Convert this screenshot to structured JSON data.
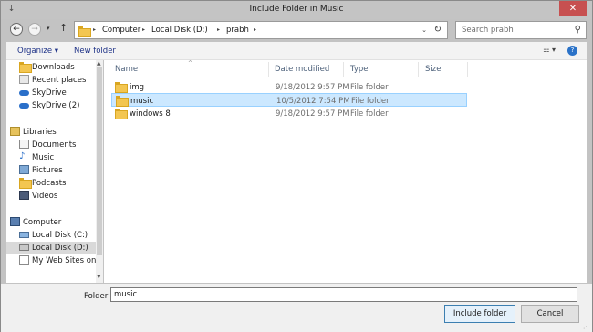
{
  "window": {
    "title": "Include Folder in Music",
    "close_glyph": "✕",
    "sys_icon": "↓"
  },
  "navigation": {
    "back_glyph": "←",
    "forward_glyph": "→",
    "recent_glyph": "▾",
    "up_glyph": "↑",
    "breadcrumb": [
      "Computer",
      "Local Disk (D:)",
      "prabh"
    ],
    "breadcrumb_sep": "▸",
    "dropdown_glyph": "⌄",
    "refresh_glyph": "↻"
  },
  "search": {
    "placeholder": "Search prabh",
    "icon_glyph": "⚲"
  },
  "toolbar": {
    "organize_label": "Organize ▾",
    "new_folder_label": "New folder",
    "view_glyph": "☷ ▾",
    "help_glyph": "?"
  },
  "sidebar": {
    "items": [
      {
        "label": "Downloads",
        "icon": "downloads-icon"
      },
      {
        "label": "Recent places",
        "icon": "recent-places-icon"
      },
      {
        "label": "SkyDrive",
        "icon": "skydrive-icon"
      },
      {
        "label": "SkyDrive (2)",
        "icon": "skydrive-icon"
      },
      {
        "label": "Libraries",
        "icon": "libraries-icon"
      },
      {
        "label": "Documents",
        "icon": "documents-icon"
      },
      {
        "label": "Music",
        "icon": "music-icon"
      },
      {
        "label": "Pictures",
        "icon": "pictures-icon"
      },
      {
        "label": "Podcasts",
        "icon": "podcasts-icon"
      },
      {
        "label": "Videos",
        "icon": "videos-icon"
      },
      {
        "label": "Computer",
        "icon": "computer-icon"
      },
      {
        "label": "Local Disk (C:)",
        "icon": "drive-icon"
      },
      {
        "label": "Local Disk (D:)",
        "icon": "drive-icon",
        "selected": true
      },
      {
        "label": "My Web Sites on",
        "icon": "web-sites-icon"
      }
    ],
    "scroll_up_glyph": "▲",
    "scroll_down_glyph": "▼"
  },
  "file_list": {
    "sort_glyph": "^",
    "columns": [
      "Name",
      "Date modified",
      "Type",
      "Size"
    ],
    "rows": [
      {
        "name": "img",
        "date": "9/18/2012 9:57 PM",
        "type": "File folder",
        "size": ""
      },
      {
        "name": "music",
        "date": "10/5/2012 7:54 PM",
        "type": "File folder",
        "size": "",
        "selected": true
      },
      {
        "name": "windows 8",
        "date": "9/18/2012 9:57 PM",
        "type": "File folder",
        "size": ""
      }
    ]
  },
  "footer": {
    "folder_label": "Folder:",
    "folder_value": "music",
    "include_label": "Include folder",
    "cancel_label": "Cancel",
    "grip_glyph": "⋰"
  },
  "colors": {
    "selection_bg": "#cce8ff",
    "selection_border": "#99d1ff",
    "link_blue": "#1e3287",
    "close_red": "#c75050",
    "folder_yellow": "#f3c651"
  }
}
